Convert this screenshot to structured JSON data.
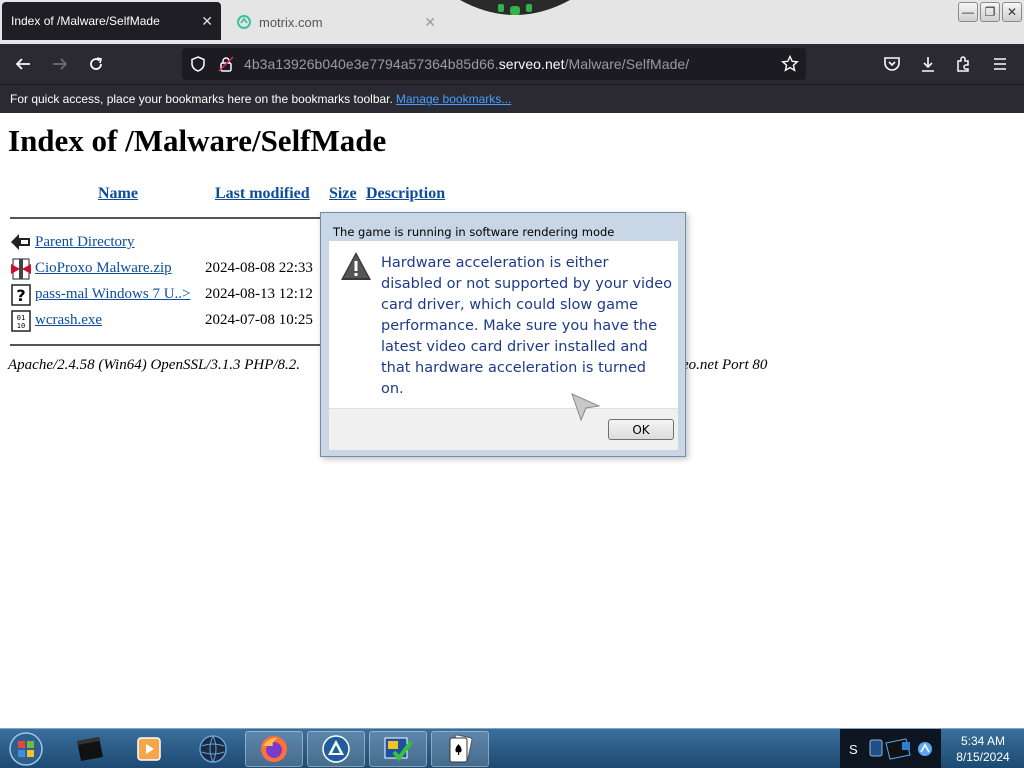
{
  "browser": {
    "tabs": [
      {
        "label": "Index of /Malware/SelfMade",
        "active": true
      },
      {
        "label": "motrix.com",
        "active": false
      }
    ],
    "url": {
      "subdomain": "4b3a13926b040e3e7794a57364b85d66.",
      "host": "serveo.net",
      "path": "/Malware/SelfMade/"
    },
    "bookmarks_bar": {
      "message": "For quick access, place your bookmarks here on the bookmarks toolbar.",
      "link": "Manage bookmarks..."
    },
    "icons": [
      "back-icon",
      "forward-icon",
      "reload-icon",
      "shield-icon",
      "lock-icon",
      "star-icon",
      "pocket-icon",
      "download-icon",
      "extensions-icon",
      "menu-icon"
    ]
  },
  "page": {
    "title": "Index of /Malware/SelfMade",
    "columns": [
      "Name",
      "Last modified",
      "Size",
      "Description"
    ],
    "rows": [
      {
        "name": "Parent Directory",
        "date": "",
        "icon": "back-folder-icon"
      },
      {
        "name": "CioProxo Malware.zip",
        "date": "2024-08-08 22:33",
        "icon": "zip-file-icon"
      },
      {
        "name": "pass-mal Windows 7 U..>",
        "date": "2024-08-13 12:12",
        "icon": "unknown-file-icon"
      },
      {
        "name": "wcrash.exe",
        "date": "2024-07-08 10:25",
        "icon": "binary-file-icon"
      }
    ],
    "address_visible": "Apache/2.4.58 (Win64) OpenSSL/3.1.3 PHP/8.2.",
    "address_tail": "eo.net Port 80"
  },
  "dialog": {
    "title": "The game is running in software rendering mode",
    "message": "Hardware acceleration is either disabled or not supported by your video card driver, which could slow game performance. Make sure you have the latest video card driver installed and that hardware acceleration is turned on.",
    "ok_label": "OK",
    "icon": "warning-icon"
  },
  "taskbar": {
    "apps": [
      "start-orb-icon",
      "dark-window-icon",
      "media-player-icon",
      "globe-icon",
      "firefox-icon",
      "app-triangle-icon",
      "checklist-app-icon",
      "solitaire-icon"
    ],
    "tray_text": "S",
    "time": "5:34 AM",
    "date": "8/15/2024"
  },
  "colors": {
    "link": "#0b4c9c",
    "browser_dark": "#2b2a33",
    "dialog_text": "#1e3b8a",
    "taskbar": "#2a5a85"
  }
}
